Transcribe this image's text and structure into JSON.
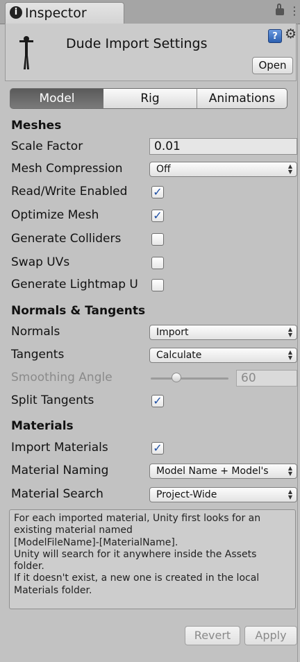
{
  "tab": {
    "label": "Inspector",
    "icon": "info-icon"
  },
  "header": {
    "title": "Dude Import Settings",
    "open_label": "Open"
  },
  "toolbar": {
    "tabs": [
      "Model",
      "Rig",
      "Animations"
    ],
    "selected": "Model"
  },
  "meshes": {
    "heading": "Meshes",
    "scale_factor": {
      "label": "Scale Factor",
      "value": "0.01"
    },
    "mesh_compression": {
      "label": "Mesh Compression",
      "value": "Off"
    },
    "read_write": {
      "label": "Read/Write Enabled",
      "checked": true
    },
    "optimize_mesh": {
      "label": "Optimize Mesh",
      "checked": true
    },
    "generate_colliders": {
      "label": "Generate Colliders",
      "checked": false
    },
    "swap_uvs": {
      "label": "Swap UVs",
      "checked": false
    },
    "generate_lightmap": {
      "label": "Generate Lightmap U",
      "checked": false
    }
  },
  "normals": {
    "heading": "Normals & Tangents",
    "normals": {
      "label": "Normals",
      "value": "Import"
    },
    "tangents": {
      "label": "Tangents",
      "value": "Calculate"
    },
    "smoothing": {
      "label": "Smoothing Angle",
      "value": "60"
    },
    "split_tangents": {
      "label": "Split Tangents",
      "checked": true
    }
  },
  "materials": {
    "heading": "Materials",
    "import_materials": {
      "label": "Import Materials",
      "checked": true
    },
    "naming": {
      "label": "Material Naming",
      "value": "Model Name + Model's"
    },
    "search": {
      "label": "Material Search",
      "value": "Project-Wide"
    }
  },
  "help_lines": [
    "For each imported material, Unity first looks for an",
    "existing material named",
    "[ModelFileName]-[MaterialName].",
    "Unity will search for it anywhere inside the Assets",
    "folder.",
    "If it doesn't exist, a new one is created in the local",
    "Materials folder."
  ],
  "footer": {
    "revert_label": "Revert",
    "apply_label": "Apply"
  },
  "colors": {
    "check": "#1f4fa3",
    "selected_tab": "#5f5f5f",
    "background": "#c2c2c2"
  }
}
